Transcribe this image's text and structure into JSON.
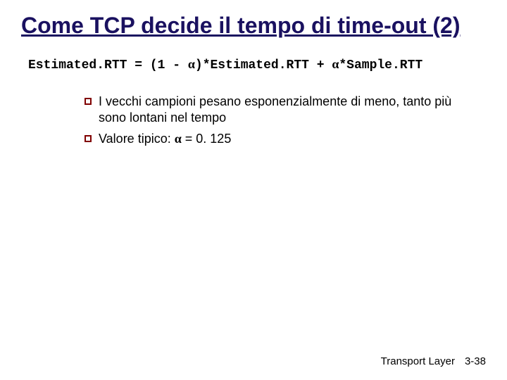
{
  "title": "Come TCP decide il tempo di time-out (2)",
  "formula": {
    "part1": "Estimated.RTT = (1 - ",
    "alpha1": "α",
    "part2": ")*Estimated.RTT + ",
    "alpha2": "α",
    "part3": "*Sample.RTT"
  },
  "bullets": [
    {
      "text": "I vecchi campioni pesano esponenzialmente di meno, tanto più sono lontani nel tempo"
    },
    {
      "prefix": "Valore tipico: ",
      "alpha": "α",
      "suffix": " = 0. 125"
    }
  ],
  "footer": {
    "label": "Transport Layer",
    "page": "3-38"
  }
}
